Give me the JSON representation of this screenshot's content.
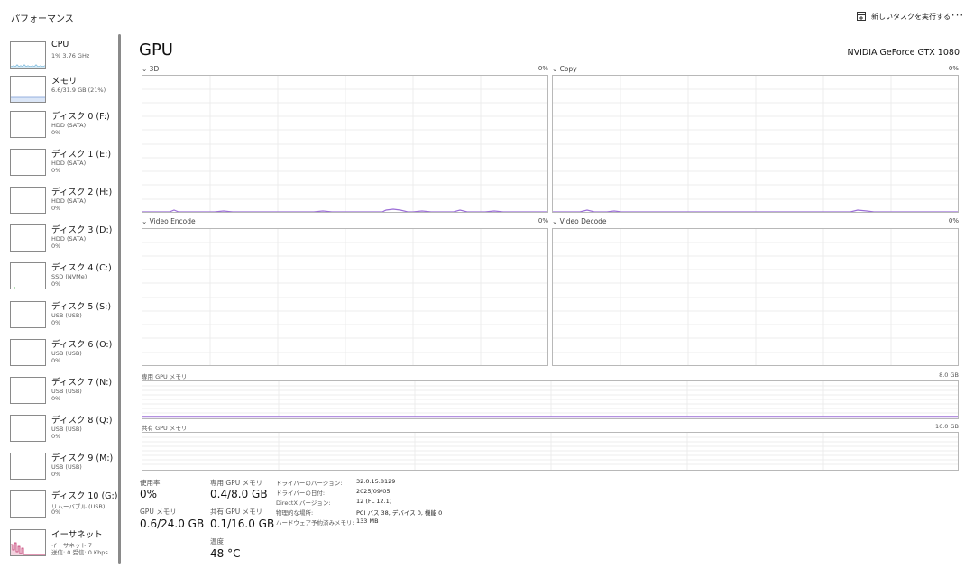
{
  "header": {
    "title": "パフォーマンス",
    "run_task_label": "新しいタスクを実行する",
    "more_label": "···"
  },
  "sidebar": {
    "items": [
      {
        "name": "CPU",
        "sub1": "1%  3.76 GHz",
        "sub2": ""
      },
      {
        "name": "メモリ",
        "sub1": "6.6/31.9 GB (21%)",
        "sub2": ""
      },
      {
        "name": "ディスク 0 (F:)",
        "sub1": "HDD (SATA)",
        "sub2": "0%"
      },
      {
        "name": "ディスク 1 (E:)",
        "sub1": "HDD (SATA)",
        "sub2": "0%"
      },
      {
        "name": "ディスク 2 (H:)",
        "sub1": "HDD (SATA)",
        "sub2": "0%"
      },
      {
        "name": "ディスク 3 (D:)",
        "sub1": "HDD (SATA)",
        "sub2": "0%"
      },
      {
        "name": "ディスク 4 (C:)",
        "sub1": "SSD (NVMe)",
        "sub2": "0%"
      },
      {
        "name": "ディスク 5 (S:)",
        "sub1": "USB (USB)",
        "sub2": "0%"
      },
      {
        "name": "ディスク 6 (O:)",
        "sub1": "USB (USB)",
        "sub2": "0%"
      },
      {
        "name": "ディスク 7 (N:)",
        "sub1": "USB (USB)",
        "sub2": "0%"
      },
      {
        "name": "ディスク 8 (Q:)",
        "sub1": "USB (USB)",
        "sub2": "0%"
      },
      {
        "name": "ディスク 9 (M:)",
        "sub1": "USB (USB)",
        "sub2": "0%"
      },
      {
        "name": "ディスク 10 (G:)",
        "sub1": "リムーバブル (USB)",
        "sub2": "0%"
      },
      {
        "name": "イーサネット",
        "sub1": "イーサネット 7",
        "sub2": "送信: 0  受信: 0 Kbps"
      }
    ]
  },
  "main": {
    "title": "GPU",
    "model": "NVIDIA GeForce GTX 1080",
    "engines": [
      {
        "label": "⌄ 3D",
        "percent": "0%"
      },
      {
        "label": "⌄ Copy",
        "percent": "0%"
      },
      {
        "label": "⌄ Video Encode",
        "percent": "0%"
      },
      {
        "label": "⌄ Video Decode",
        "percent": "0%"
      }
    ],
    "dedicated_mem": {
      "label": "専用 GPU メモリ",
      "max": "8.0 GB"
    },
    "shared_mem": {
      "label": "共有 GPU メモリ",
      "max": "16.0 GB"
    },
    "stats": {
      "usage_label": "使用率",
      "usage_value": "0%",
      "gpu_mem_label": "GPU メモリ",
      "gpu_mem_value": "0.6/24.0 GB",
      "ded_label": "専用 GPU メモリ",
      "ded_value": "0.4/8.0 GB",
      "shared_label": "共有 GPU メモリ",
      "shared_value": "0.1/16.0 GB",
      "temp_label": "温度",
      "temp_value": "48 °C"
    },
    "info": {
      "driver_version_key": "ドライバーのバージョン:",
      "driver_version_val": "32.0.15.8129",
      "driver_date_key": "ドライバーの日付:",
      "driver_date_val": "2025/09/05",
      "directx_key": "DirectX バージョン:",
      "directx_val": "12 (FL 12.1)",
      "location_key": "物理的な場所:",
      "location_val": "PCI バス 38, デバイス 0, 機能 0",
      "reserved_key": "ハードウェア予約済みメモリ:",
      "reserved_val": "133 MB"
    }
  },
  "colors": {
    "gpu_accent": "#9b6dd6",
    "cpu_accent": "#2f8fc5",
    "memory_accent": "#7a9ad6",
    "disk_accent": "#4caf50",
    "ethernet_accent": "#c0306a"
  },
  "icons": {
    "run_task": "new-task-icon",
    "more": "more-icon"
  }
}
